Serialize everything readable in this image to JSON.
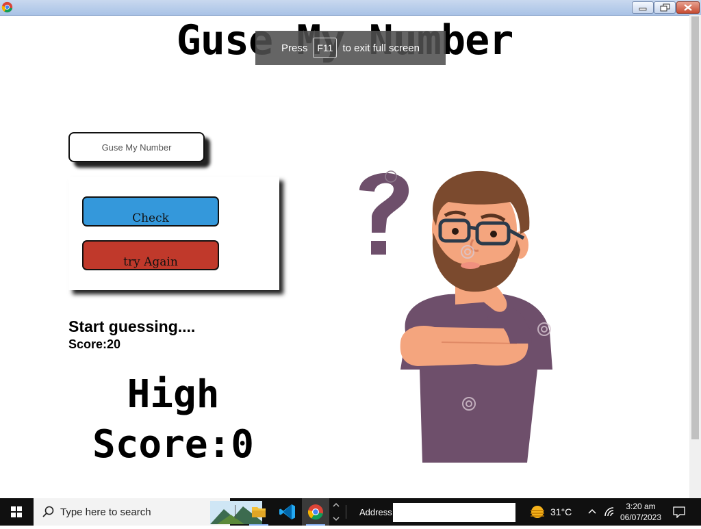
{
  "page": {
    "title": "Guse My Number",
    "input_placeholder": "Guse My Number",
    "check_label": "Check",
    "try_again_label": "try Again",
    "message": "Start guessing....",
    "score": "Score:20",
    "high_score": "High Score:0",
    "illustration_watermark": "dreamstime"
  },
  "fullscreen_toast": {
    "prefix": "Press",
    "key": "F11",
    "suffix": "to exit full screen"
  },
  "taskbar": {
    "search_placeholder": "Type here to search",
    "address_label": "Address",
    "address_value": "",
    "temperature": "31°C",
    "time": "3:20 am",
    "date": "06/07/2023",
    "pinned_apps": [
      "file-explorer",
      "visual-studio-code",
      "google-chrome"
    ]
  },
  "colors": {
    "check_button": "#3498db",
    "try_again_button": "#c0392b",
    "shirt": "#6e4f6b",
    "skin": "#f4a57e",
    "hair": "#7b4a2e",
    "question_mark": "#6e4f6b"
  }
}
